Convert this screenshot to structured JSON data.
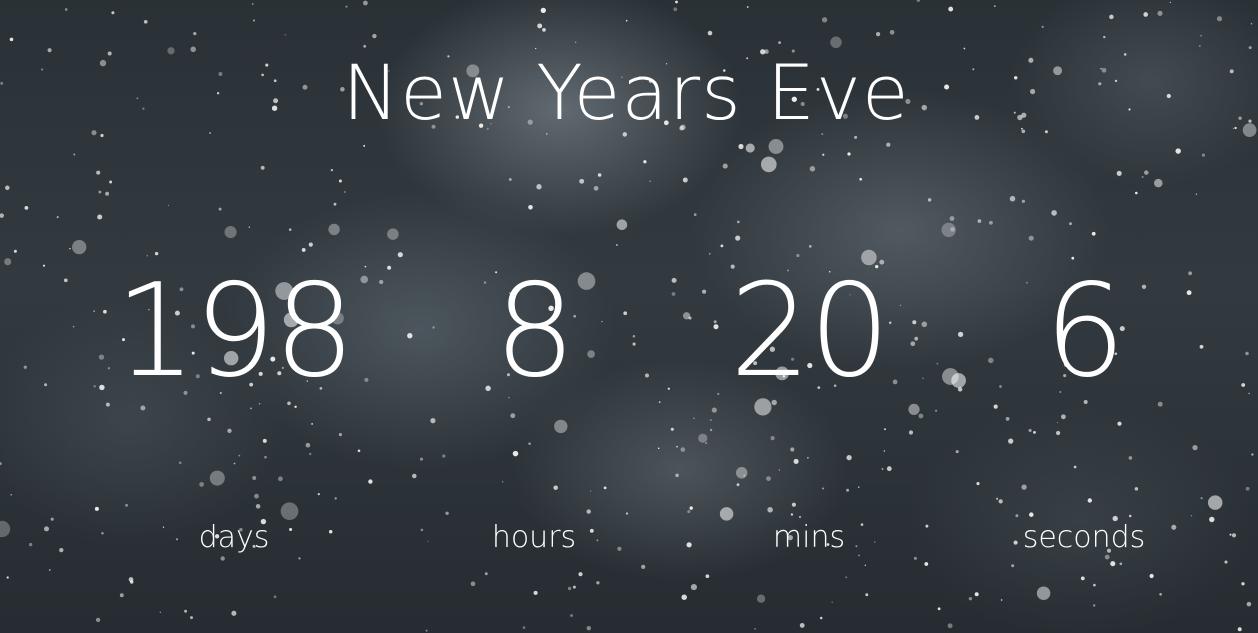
{
  "title": "New Years Eve",
  "countdown": {
    "days": {
      "value": "198",
      "label": "days"
    },
    "hours": {
      "value": "8",
      "label": "hours"
    },
    "mins": {
      "value": "20",
      "label": "mins"
    },
    "seconds": {
      "value": "6",
      "label": "seconds"
    }
  },
  "colors": {
    "text": "#ffffff",
    "background": "#2c3338"
  }
}
